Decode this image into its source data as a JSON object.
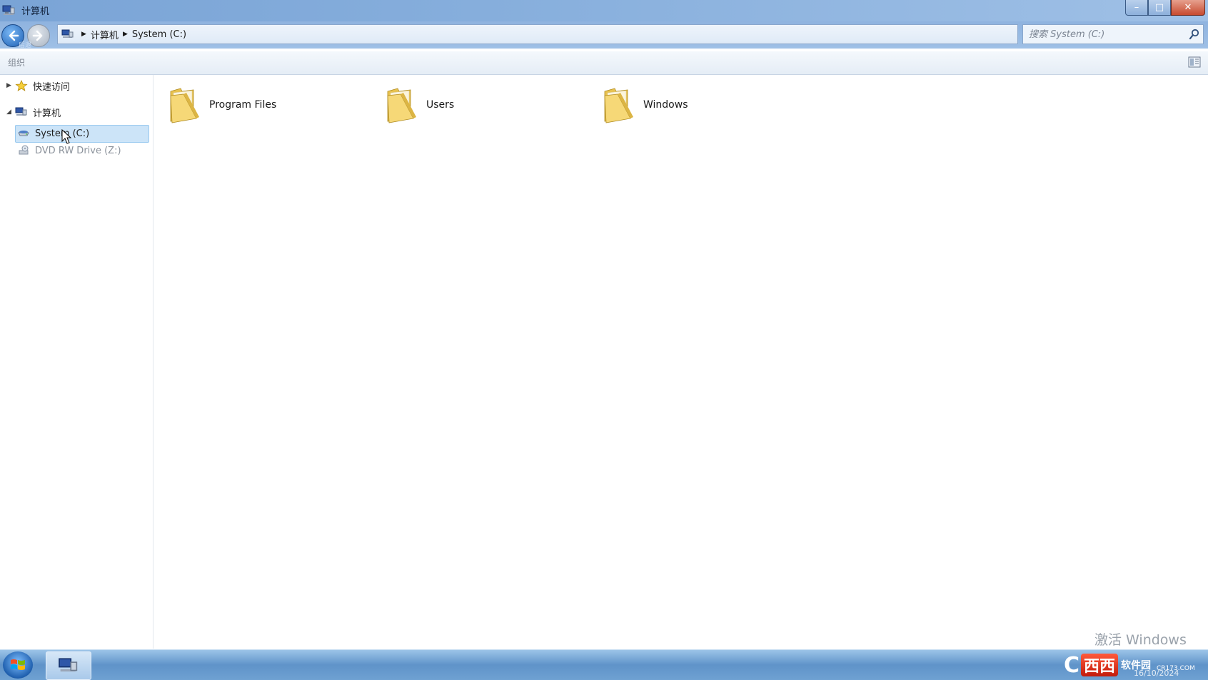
{
  "window": {
    "title": "计算机",
    "controls": {
      "minimize": "–",
      "maximize": "□",
      "close": "✕"
    }
  },
  "nav": {
    "back_hint": "后退"
  },
  "address": {
    "crumbs": [
      "计算机",
      "System (C:)"
    ],
    "search_placeholder": "搜索 System (C:)"
  },
  "toolbar": {
    "organize_label": "组织"
  },
  "sidebar": {
    "quick_access": "快速访问",
    "computer": "计算机",
    "drives": [
      {
        "label": "System (C:)",
        "selected": true
      },
      {
        "label": "DVD RW Drive (Z:)",
        "selected": false
      }
    ]
  },
  "content": {
    "folders": [
      {
        "name": "Program Files"
      },
      {
        "name": "Users"
      },
      {
        "name": "Windows"
      }
    ]
  },
  "watermark": {
    "text": "激活 Windows"
  },
  "taskbar": {
    "logo_text": "西西",
    "logo_sub": "软件园",
    "logo_domain": "CR173.COM",
    "date": "16/10/2024"
  },
  "colors": {
    "selection_bg": "#cce4f8",
    "folder_yellow": "#f3d36b",
    "titlebar": "#86aedc"
  }
}
